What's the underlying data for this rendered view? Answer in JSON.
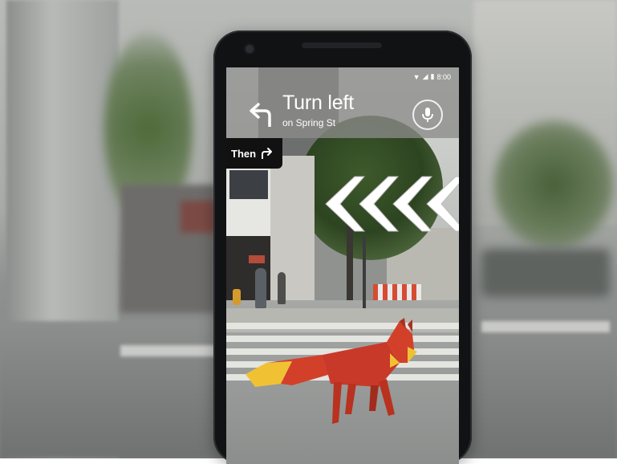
{
  "status_bar": {
    "time": "8:00"
  },
  "navigation": {
    "instruction": "Turn left",
    "street": "on Spring St",
    "next_label": "Then",
    "turn_icon": "turn-left-arrow-icon",
    "next_icon": "turn-right-arrow-icon",
    "mic_icon": "microphone-icon"
  },
  "ar_overlay": {
    "direction_chevrons": 4,
    "chevron_color": "#ffffff",
    "guide_character": "fox"
  },
  "colors": {
    "nav_card": "#8c8c8a",
    "then_chip": "#111111",
    "fox_orange": "#d2402a",
    "fox_tail_tip": "#f0c233"
  }
}
